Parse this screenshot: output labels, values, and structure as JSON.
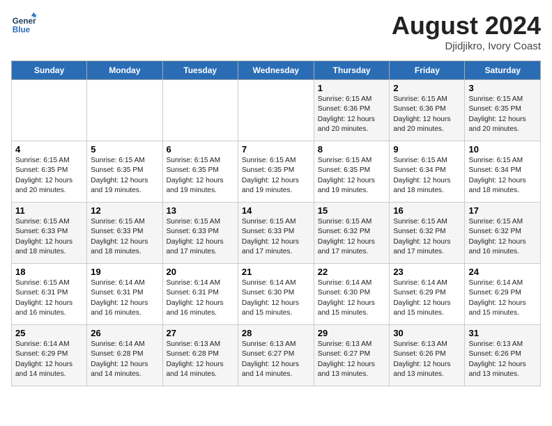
{
  "header": {
    "logo_line1": "General",
    "logo_line2": "Blue",
    "month_year": "August 2024",
    "location": "Djidjikro, Ivory Coast"
  },
  "days_of_week": [
    "Sunday",
    "Monday",
    "Tuesday",
    "Wednesday",
    "Thursday",
    "Friday",
    "Saturday"
  ],
  "weeks": [
    [
      {
        "day": "",
        "info": ""
      },
      {
        "day": "",
        "info": ""
      },
      {
        "day": "",
        "info": ""
      },
      {
        "day": "",
        "info": ""
      },
      {
        "day": "1",
        "info": "Sunrise: 6:15 AM\nSunset: 6:36 PM\nDaylight: 12 hours\nand 20 minutes."
      },
      {
        "day": "2",
        "info": "Sunrise: 6:15 AM\nSunset: 6:36 PM\nDaylight: 12 hours\nand 20 minutes."
      },
      {
        "day": "3",
        "info": "Sunrise: 6:15 AM\nSunset: 6:35 PM\nDaylight: 12 hours\nand 20 minutes."
      }
    ],
    [
      {
        "day": "4",
        "info": "Sunrise: 6:15 AM\nSunset: 6:35 PM\nDaylight: 12 hours\nand 20 minutes."
      },
      {
        "day": "5",
        "info": "Sunrise: 6:15 AM\nSunset: 6:35 PM\nDaylight: 12 hours\nand 19 minutes."
      },
      {
        "day": "6",
        "info": "Sunrise: 6:15 AM\nSunset: 6:35 PM\nDaylight: 12 hours\nand 19 minutes."
      },
      {
        "day": "7",
        "info": "Sunrise: 6:15 AM\nSunset: 6:35 PM\nDaylight: 12 hours\nand 19 minutes."
      },
      {
        "day": "8",
        "info": "Sunrise: 6:15 AM\nSunset: 6:35 PM\nDaylight: 12 hours\nand 19 minutes."
      },
      {
        "day": "9",
        "info": "Sunrise: 6:15 AM\nSunset: 6:34 PM\nDaylight: 12 hours\nand 18 minutes."
      },
      {
        "day": "10",
        "info": "Sunrise: 6:15 AM\nSunset: 6:34 PM\nDaylight: 12 hours\nand 18 minutes."
      }
    ],
    [
      {
        "day": "11",
        "info": "Sunrise: 6:15 AM\nSunset: 6:33 PM\nDaylight: 12 hours\nand 18 minutes."
      },
      {
        "day": "12",
        "info": "Sunrise: 6:15 AM\nSunset: 6:33 PM\nDaylight: 12 hours\nand 18 minutes."
      },
      {
        "day": "13",
        "info": "Sunrise: 6:15 AM\nSunset: 6:33 PM\nDaylight: 12 hours\nand 17 minutes."
      },
      {
        "day": "14",
        "info": "Sunrise: 6:15 AM\nSunset: 6:33 PM\nDaylight: 12 hours\nand 17 minutes."
      },
      {
        "day": "15",
        "info": "Sunrise: 6:15 AM\nSunset: 6:32 PM\nDaylight: 12 hours\nand 17 minutes."
      },
      {
        "day": "16",
        "info": "Sunrise: 6:15 AM\nSunset: 6:32 PM\nDaylight: 12 hours\nand 17 minutes."
      },
      {
        "day": "17",
        "info": "Sunrise: 6:15 AM\nSunset: 6:32 PM\nDaylight: 12 hours\nand 16 minutes."
      }
    ],
    [
      {
        "day": "18",
        "info": "Sunrise: 6:15 AM\nSunset: 6:31 PM\nDaylight: 12 hours\nand 16 minutes."
      },
      {
        "day": "19",
        "info": "Sunrise: 6:14 AM\nSunset: 6:31 PM\nDaylight: 12 hours\nand 16 minutes."
      },
      {
        "day": "20",
        "info": "Sunrise: 6:14 AM\nSunset: 6:31 PM\nDaylight: 12 hours\nand 16 minutes."
      },
      {
        "day": "21",
        "info": "Sunrise: 6:14 AM\nSunset: 6:30 PM\nDaylight: 12 hours\nand 15 minutes."
      },
      {
        "day": "22",
        "info": "Sunrise: 6:14 AM\nSunset: 6:30 PM\nDaylight: 12 hours\nand 15 minutes."
      },
      {
        "day": "23",
        "info": "Sunrise: 6:14 AM\nSunset: 6:29 PM\nDaylight: 12 hours\nand 15 minutes."
      },
      {
        "day": "24",
        "info": "Sunrise: 6:14 AM\nSunset: 6:29 PM\nDaylight: 12 hours\nand 15 minutes."
      }
    ],
    [
      {
        "day": "25",
        "info": "Sunrise: 6:14 AM\nSunset: 6:29 PM\nDaylight: 12 hours\nand 14 minutes."
      },
      {
        "day": "26",
        "info": "Sunrise: 6:14 AM\nSunset: 6:28 PM\nDaylight: 12 hours\nand 14 minutes."
      },
      {
        "day": "27",
        "info": "Sunrise: 6:13 AM\nSunset: 6:28 PM\nDaylight: 12 hours\nand 14 minutes."
      },
      {
        "day": "28",
        "info": "Sunrise: 6:13 AM\nSunset: 6:27 PM\nDaylight: 12 hours\nand 14 minutes."
      },
      {
        "day": "29",
        "info": "Sunrise: 6:13 AM\nSunset: 6:27 PM\nDaylight: 12 hours\nand 13 minutes."
      },
      {
        "day": "30",
        "info": "Sunrise: 6:13 AM\nSunset: 6:26 PM\nDaylight: 12 hours\nand 13 minutes."
      },
      {
        "day": "31",
        "info": "Sunrise: 6:13 AM\nSunset: 6:26 PM\nDaylight: 12 hours\nand 13 minutes."
      }
    ]
  ]
}
